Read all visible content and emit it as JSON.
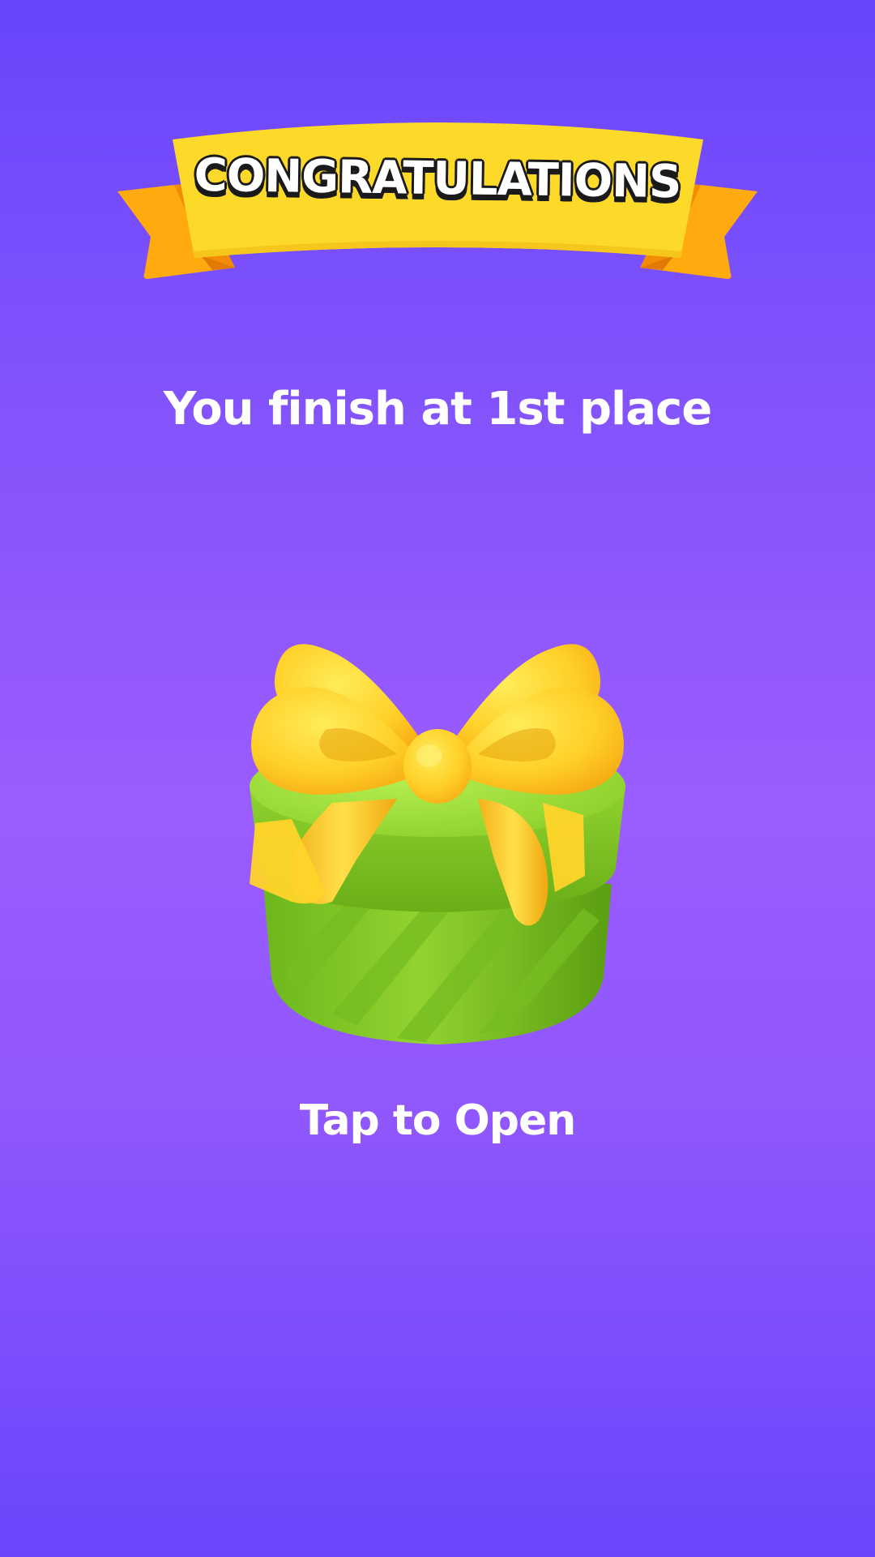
{
  "banner": {
    "title": "CONGRATULATIONS"
  },
  "result": {
    "message": "You finish at 1st place"
  },
  "gift": {
    "icon": "gift-box-icon",
    "colors": {
      "box": "#8fd22f",
      "ribbon": "#ffd42a"
    }
  },
  "action": {
    "label": "Tap to Open"
  },
  "colors": {
    "background_top": "#6845fb",
    "background_mid": "#9b5cfe",
    "banner_yellow": "#fdd92a",
    "banner_orange": "#ffaa0e",
    "text": "#ffffff"
  }
}
